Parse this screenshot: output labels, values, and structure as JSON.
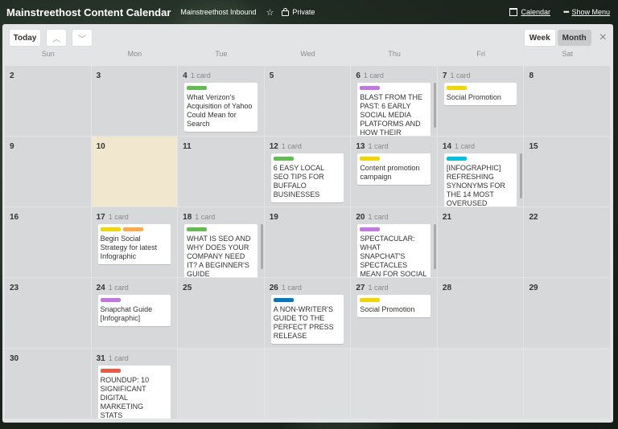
{
  "board": {
    "title": "Mainstreethost Content Calendar",
    "team": "Mainstreethost Inbound",
    "visibility": "Private",
    "calendar_link": "Calendar",
    "menu_link": "Show Menu"
  },
  "controls": {
    "today": "Today",
    "prev": "^",
    "next": "v",
    "week": "Week",
    "month": "Month",
    "close": "×"
  },
  "days_of_week": [
    "Sun",
    "Mon",
    "Tue",
    "Wed",
    "Thu",
    "Fri",
    "Sat"
  ],
  "colors": {
    "green": "#61bd4f",
    "purple": "#c377e0",
    "yellow": "#f2d600",
    "orange": "#ffab4a",
    "blue": "#0079bf",
    "red": "#eb5a46",
    "sky": "#00c2e0"
  },
  "weeks": [
    [
      {
        "day": "2"
      },
      {
        "day": "3"
      },
      {
        "day": "4",
        "count": "1 card",
        "card": {
          "labels": [
            "green"
          ],
          "text": "What Verizon's Acquisition of Yahoo Could Mean for Search"
        }
      },
      {
        "day": "5"
      },
      {
        "day": "6",
        "count": "1 card",
        "card": {
          "labels": [
            "purple"
          ],
          "text": "BLAST FROM THE PAST: 6 EARLY SOCIAL MEDIA PLATFORMS AND HOW THEIR",
          "overflow": true
        }
      },
      {
        "day": "7",
        "count": "1 card",
        "card": {
          "labels": [
            "yellow"
          ],
          "text": "Social Promotion"
        }
      },
      {
        "day": "8"
      }
    ],
    [
      {
        "day": "9"
      },
      {
        "day": "10",
        "today": true
      },
      {
        "day": "11"
      },
      {
        "day": "12",
        "count": "1 card",
        "card": {
          "labels": [
            "green"
          ],
          "text": "6 EASY LOCAL SEO TIPS FOR BUFFALO BUSINESSES"
        }
      },
      {
        "day": "13",
        "count": "1 card",
        "card": {
          "labels": [
            "yellow"
          ],
          "text": "Content promotion campaign"
        }
      },
      {
        "day": "14",
        "count": "1 card",
        "card": {
          "labels": [
            "sky"
          ],
          "text": "[INFOGRAPHIC] REFRESHING SYNONYMS FOR THE 14 MOST OVERUSED",
          "overflow": true
        }
      },
      {
        "day": "15"
      }
    ],
    [
      {
        "day": "16"
      },
      {
        "day": "17",
        "count": "1 card",
        "card": {
          "labels": [
            "yellow",
            "orange"
          ],
          "text": "Begin Social Strategy for latest Infographic"
        }
      },
      {
        "day": "18",
        "count": "1 card",
        "card": {
          "labels": [
            "green"
          ],
          "text": "WHAT IS SEO AND WHY DOES YOUR COMPANY NEED IT? A BEGINNER'S GUIDE",
          "overflow": true
        }
      },
      {
        "day": "19"
      },
      {
        "day": "20",
        "count": "1 card",
        "card": {
          "labels": [
            "purple"
          ],
          "text": "SPECTACULAR: WHAT SNAPCHAT'S SPECTACLES MEAN FOR SOCIAL MEDIA",
          "overflow": true
        }
      },
      {
        "day": "21"
      },
      {
        "day": "22"
      }
    ],
    [
      {
        "day": "23"
      },
      {
        "day": "24",
        "count": "1 card",
        "card": {
          "labels": [
            "purple"
          ],
          "text": "Snapchat Guide [Infographic]"
        }
      },
      {
        "day": "25"
      },
      {
        "day": "26",
        "count": "1 card",
        "card": {
          "labels": [
            "blue"
          ],
          "text": "A NON-WRITER'S GUIDE TO THE PERFECT PRESS RELEASE"
        }
      },
      {
        "day": "27",
        "count": "1 card",
        "card": {
          "labels": [
            "yellow"
          ],
          "text": "Social Promotion"
        }
      },
      {
        "day": "28"
      },
      {
        "day": "29"
      }
    ],
    [
      {
        "day": "30"
      },
      {
        "day": "31",
        "count": "1 card",
        "card": {
          "labels": [
            "red"
          ],
          "text": "ROUNDUP: 10 SIGNIFICANT DIGITAL MARKETING STATS"
        }
      },
      {
        "empty": true
      },
      {
        "empty": true
      },
      {
        "empty": true
      },
      {
        "empty": true
      },
      {
        "empty": true
      }
    ]
  ]
}
